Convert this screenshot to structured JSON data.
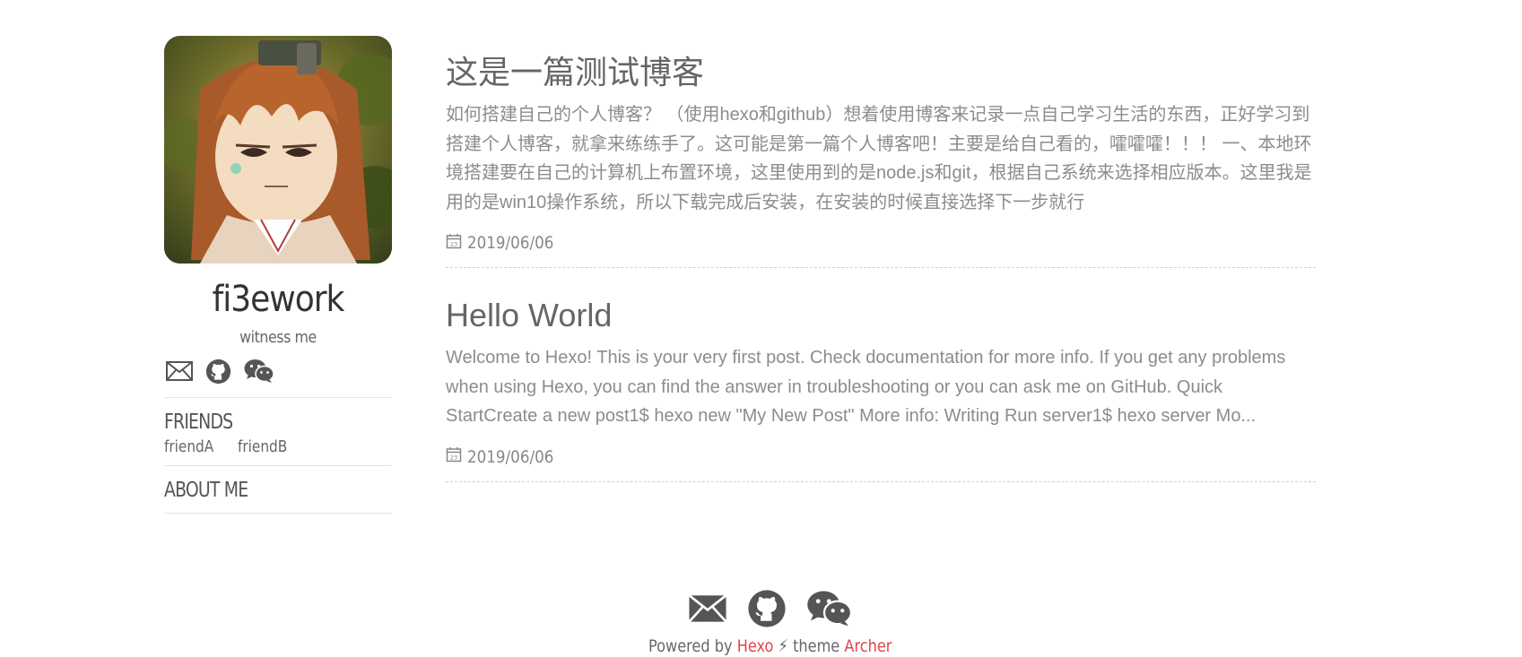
{
  "author": {
    "name": "fi3ework",
    "tagline": "witness me"
  },
  "social": {
    "icons": [
      "mail-icon",
      "github-icon",
      "wechat-icon"
    ]
  },
  "friends": {
    "title": "FRIENDS",
    "links": [
      "friendA",
      "friendB"
    ]
  },
  "about": {
    "title": "ABOUT ME"
  },
  "posts": [
    {
      "title": "这是一篇测试博客",
      "excerpt": "如何搭建自己的个人博客？ （使用hexo和github）想着使用博客来记录一点自己学习生活的东西，正好学习到搭建个人博客，就拿来练练手了。这可能是第一篇个人博客吧！主要是给自己看的，嚯嚯嚯！！！ 一、本地环境搭建要在自己的计算机上布置环境，这里使用到的是node.js和git，根据自己系统来选择相应版本。这里我是用的是win10操作系统，所以下载完成后安装，在安装的时候直接选择下一步就行",
      "date": "2019/06/06"
    },
    {
      "title": "Hello World",
      "excerpt": "Welcome to Hexo! This is your very first post. Check documentation for more info. If you get any problems when using Hexo, you can find the answer in troubleshooting or you can ask me on GitHub. Quick StartCreate a new post1$ hexo new \"My New Post\" More info: Writing Run server1$ hexo server Mo...",
      "date": "2019/06/06"
    }
  ],
  "footer": {
    "powered_by": "Powered by",
    "hexo_link": "Hexo",
    "theme_label": "theme",
    "theme_link": "Archer",
    "bolt": "⚡"
  },
  "colors": {
    "accent": "#e0434b",
    "text": "#777777",
    "icon": "#555555"
  }
}
